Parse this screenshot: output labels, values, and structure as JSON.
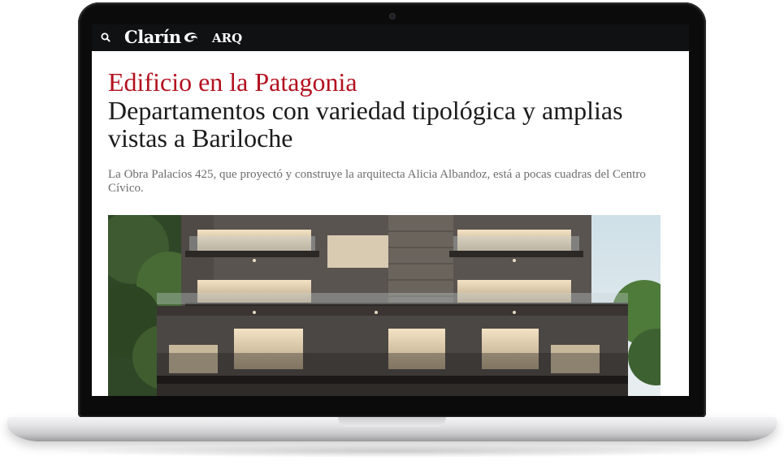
{
  "header": {
    "brand": "Clarín",
    "section": "ARQ"
  },
  "article": {
    "kicker": "Edificio en la Patagonia",
    "headline": "Departamentos con variedad tipológica y amplias vistas a Bariloche",
    "summary": "La Obra Palacios 425, que proyectó y construye la arquitecta Alicia Albandoz, está a pocas cuadras del Centro Cívico."
  },
  "colors": {
    "header_bg": "#101112",
    "kicker": "#b3101f",
    "headline": "#1b1b1b",
    "summary": "#6d6d6d"
  },
  "icons": [
    "search-icon",
    "clarin-logo-swirl-icon",
    "camera-icon"
  ]
}
